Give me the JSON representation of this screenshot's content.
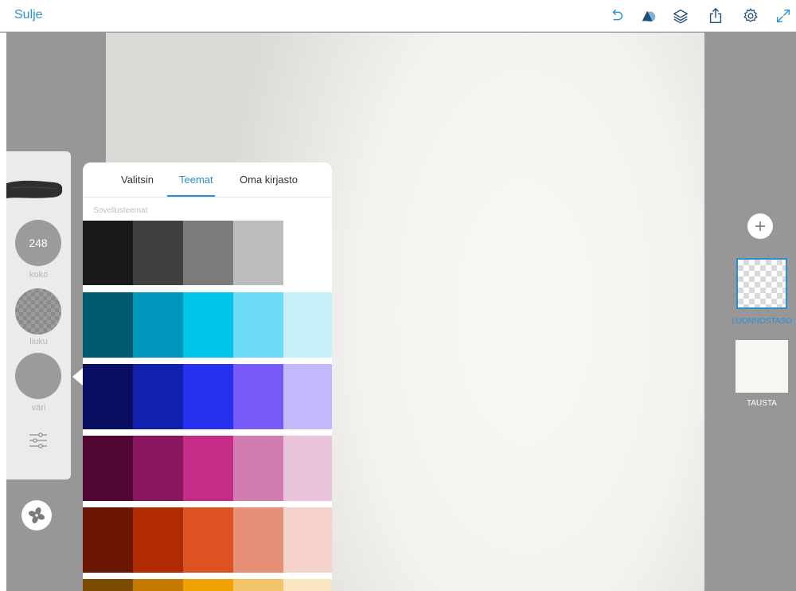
{
  "topbar": {
    "close_label": "Sulje",
    "icons": [
      "undo-icon",
      "shape-icon",
      "layers-icon",
      "share-icon",
      "settings-gear-icon",
      "expand-icon"
    ]
  },
  "tools": {
    "brush_size": "248",
    "size_label": "koko",
    "flow_label": "liuku",
    "color_label": "väri"
  },
  "color_popover": {
    "tabs": [
      {
        "label": "Valitsin",
        "active": false
      },
      {
        "label": "Teemat",
        "active": true
      },
      {
        "label": "Oma kirjasto",
        "active": false
      }
    ],
    "section_label": "Sovellusteemat",
    "themes": [
      [
        "#191919",
        "#404040",
        "#7b7b7b",
        "#bcbcbc",
        "#ffffff"
      ],
      [
        "#005a70",
        "#0097bc",
        "#00c3e8",
        "#6bdaf6",
        "#c8f0fa"
      ],
      [
        "#0a0e63",
        "#1221ad",
        "#2632ef",
        "#775af7",
        "#c2b8fc"
      ],
      [
        "#510634",
        "#8b1660",
        "#c42c88",
        "#d27bb0",
        "#e9c3da"
      ],
      [
        "#6b1503",
        "#b02a02",
        "#dc5220",
        "#e69077",
        "#f5d2c9"
      ],
      [
        "#7a4b00",
        "#c47a00",
        "#f0a300",
        "#f3c36a",
        "#fbe6c1"
      ]
    ]
  },
  "layers": {
    "sketch_layer_label": "LUONNOSTASO",
    "background_label": "TAUSTA"
  },
  "colors": {
    "accent": "#2b8fd6",
    "toolbar_icon": "#1f4e79"
  }
}
